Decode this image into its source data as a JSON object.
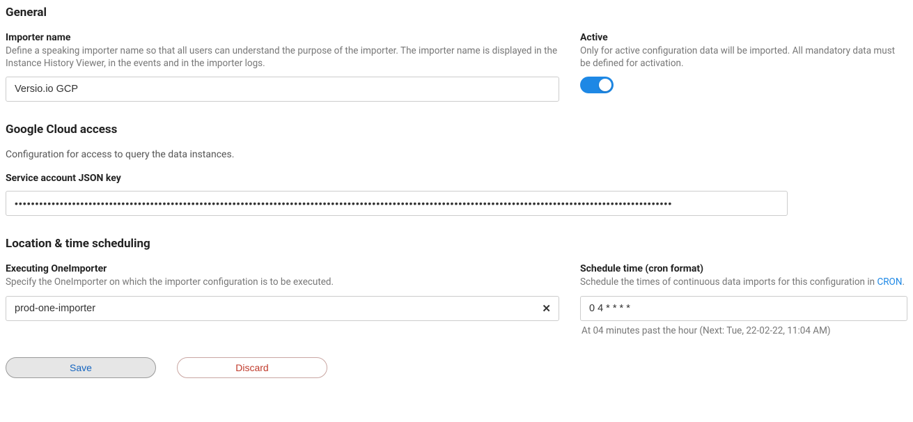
{
  "general": {
    "heading": "General",
    "importer_name": {
      "label": "Importer name",
      "help": "Define a speaking importer name so that all users can understand the purpose of the importer. The importer name is displayed in the Instance History Viewer, in the events and in the importer logs.",
      "value": "Versio.io GCP"
    },
    "active": {
      "label": "Active",
      "help": "Only for active configuration data will be imported. All mandatory data must be defined for activation.",
      "on": true
    }
  },
  "gcp": {
    "heading": "Google Cloud access",
    "subtext": "Configuration for access to query the data instances.",
    "json_key": {
      "label": "Service account JSON key",
      "value": "●●●●●●●●●●●●●●●●●●●●●●●●●●●●●●●●●●●●●●●●●●●●●●●●●●●●●●●●●●●●●●●●●●●●●●●●●●●●●●●●●●●●●●●●●●●●●●●●●●●●●●●●●●●●●●●●●●●●●●●●●●●●●●●●●●●●●●●●●●●●●●●●●●●●●●●●●●●●●●●●"
    }
  },
  "scheduling": {
    "heading": "Location & time scheduling",
    "executor": {
      "label": "Executing OneImporter",
      "help": "Specify the OneImporter on which the importer configuration is to be executed.",
      "value": "prod-one-importer"
    },
    "cron": {
      "label": "Schedule time (cron format)",
      "help_prefix": "Schedule the times of continuous data imports for this configuration in ",
      "help_link": "CRON",
      "help_suffix": ".",
      "value": "0 4 * * * *",
      "next": "At 04 minutes past the hour (Next: Tue, 22-02-22, 11:04 AM)"
    }
  },
  "buttons": {
    "save": "Save",
    "discard": "Discard"
  }
}
